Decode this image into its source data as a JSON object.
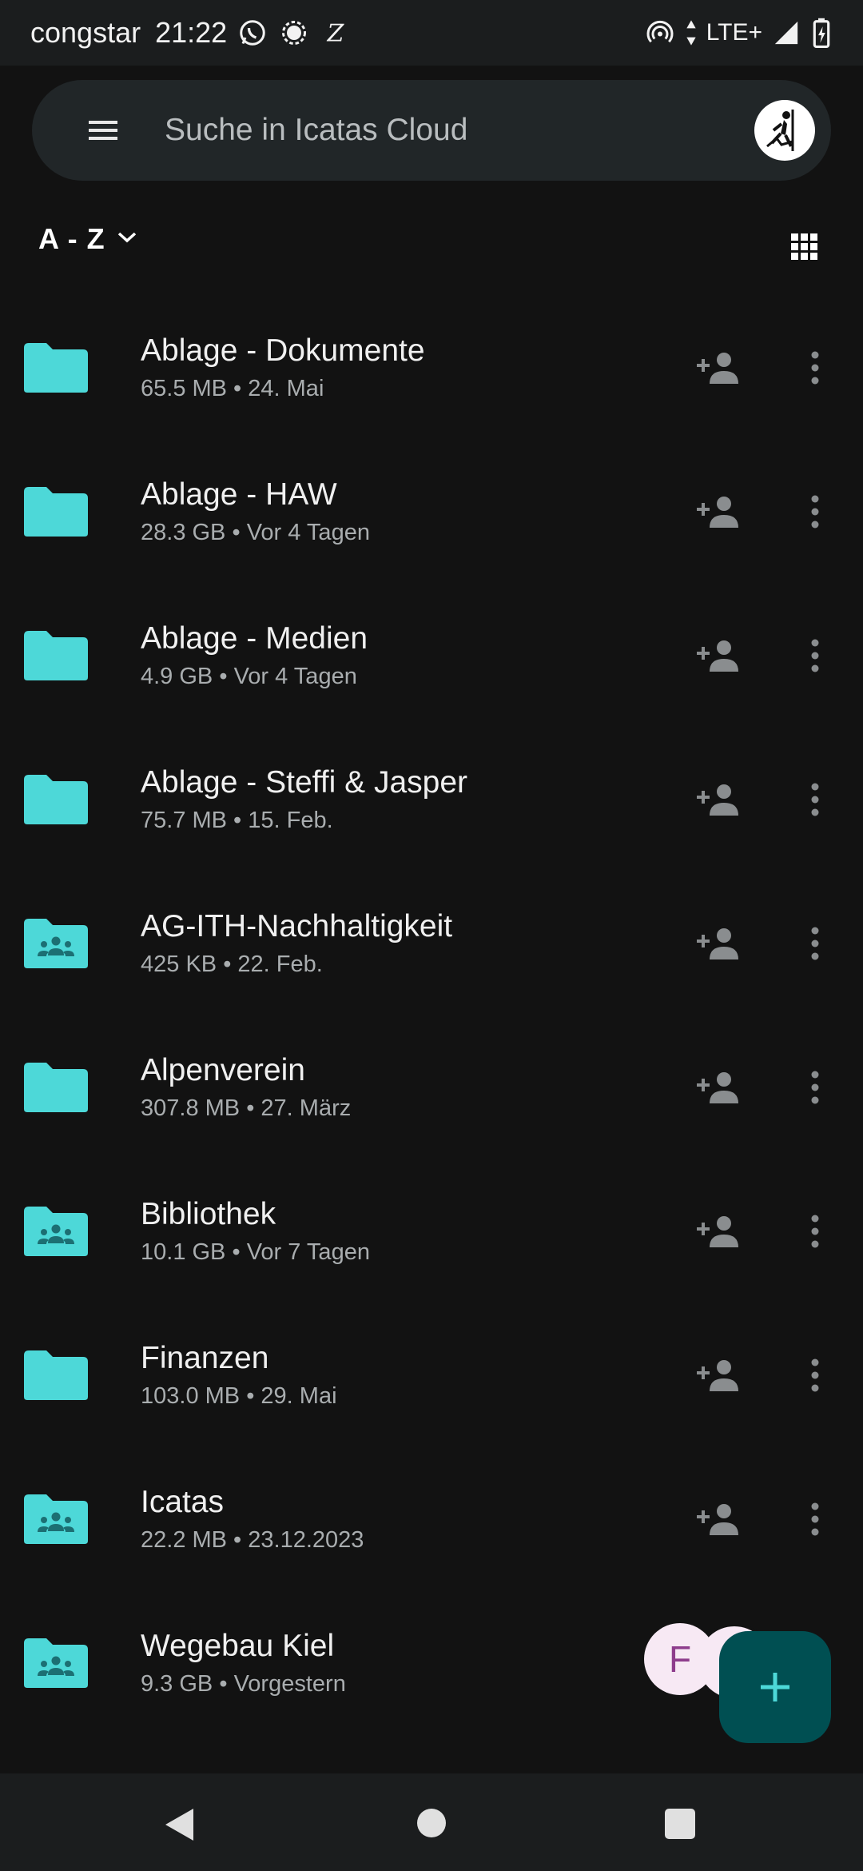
{
  "status_bar": {
    "carrier": "congstar",
    "time": "21:22",
    "network": "LTE+",
    "icons": [
      "whatsapp-icon",
      "signal-app-icon",
      "z-app-icon",
      "hotspot-icon",
      "data-arrows-icon",
      "signal-strength-icon",
      "battery-charging-icon"
    ]
  },
  "search": {
    "placeholder": "Suche in Icatas Cloud"
  },
  "sort": {
    "label": "A - Z"
  },
  "files": [
    {
      "name": "Ablage - Dokumente",
      "size": "65.5 MB",
      "date": "24. Mai",
      "type": "folder"
    },
    {
      "name": "Ablage - HAW",
      "size": "28.3 GB",
      "date": "Vor 4 Tagen",
      "type": "folder"
    },
    {
      "name": "Ablage - Medien",
      "size": "4.9 GB",
      "date": "Vor 4 Tagen",
      "type": "folder"
    },
    {
      "name": "Ablage - Steffi & Jasper",
      "size": "75.7 MB",
      "date": "15. Feb.",
      "type": "folder"
    },
    {
      "name": "AG-ITH-Nachhaltigkeit",
      "size": "425 KB",
      "date": "22. Feb.",
      "type": "group-folder"
    },
    {
      "name": "Alpenverein",
      "size": "307.8 MB",
      "date": "27. März",
      "type": "folder"
    },
    {
      "name": "Bibliothek",
      "size": "10.1 GB",
      "date": "Vor 7 Tagen",
      "type": "group-folder"
    },
    {
      "name": "Finanzen",
      "size": "103.0 MB",
      "date": "29. Mai",
      "type": "folder"
    },
    {
      "name": "Icatas",
      "size": "22.2 MB",
      "date": "23.12.2023",
      "type": "group-folder"
    },
    {
      "name": "Wegebau Kiel",
      "size": "9.3 GB",
      "date": "Vorgestern",
      "type": "group-folder"
    }
  ],
  "sharee": {
    "initial": "F"
  },
  "colors": {
    "accent": "#4dd8d8",
    "background": "#121212",
    "fab": "#004f52"
  }
}
